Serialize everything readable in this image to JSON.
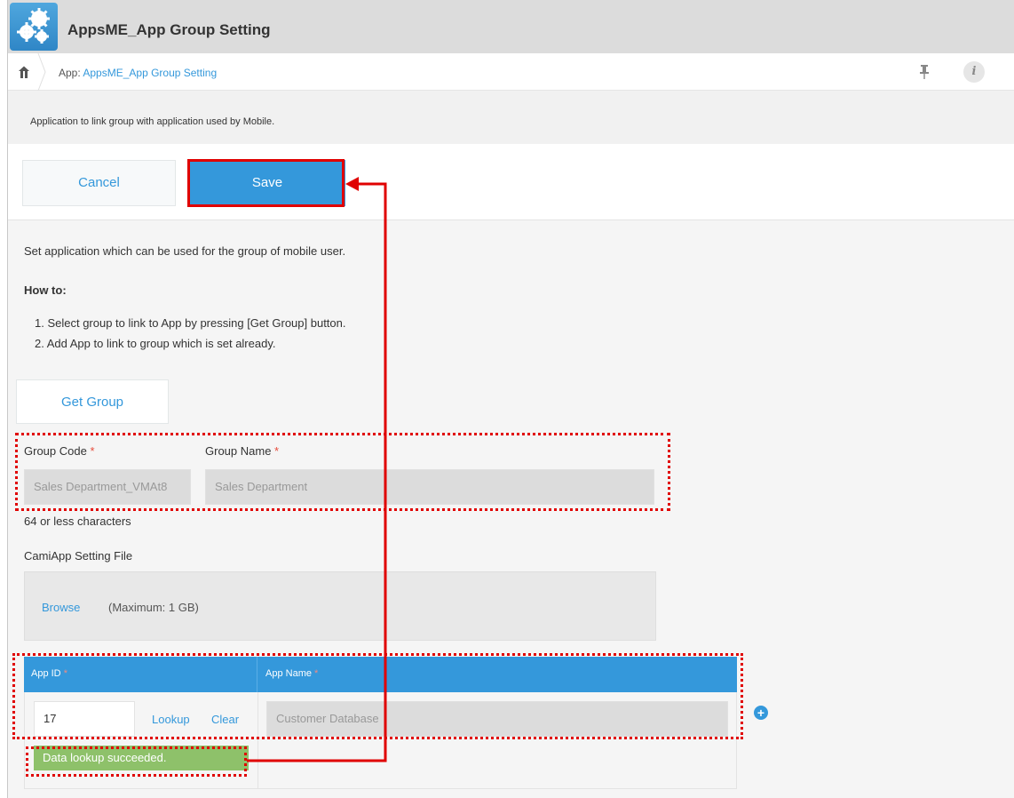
{
  "header": {
    "app_title": "AppsME_App Group Setting"
  },
  "breadcrumb": {
    "prefix": "App: ",
    "link": "AppsME_App Group Setting"
  },
  "description": "Application to link group with application used by Mobile.",
  "toolbar": {
    "cancel_label": "Cancel",
    "save_label": "Save"
  },
  "intro": {
    "text": "Set application which can be used for the group of mobile user.",
    "howto_label": "How to:",
    "steps": [
      "1. Select group to link to App by pressing [Get Group] button.",
      "2. Add App to link to group which is set already."
    ]
  },
  "get_group_label": "Get Group",
  "group": {
    "code_label": "Group Code",
    "code_value": "Sales Department_VMAt8",
    "name_label": "Group Name",
    "name_value": "Sales Department",
    "required_mark": "*",
    "hint": "64 or less characters"
  },
  "file": {
    "label": "CamiApp Setting File",
    "browse_label": "Browse",
    "max_size": "(Maximum: 1 GB)"
  },
  "table": {
    "col_app_id": "App ID",
    "col_app_name": "App Name",
    "row": {
      "app_id": "17",
      "lookup_label": "Lookup",
      "clear_label": "Clear",
      "app_name": "Customer Database"
    },
    "status": "Data lookup succeeded.",
    "add_symbol": "+"
  },
  "colors": {
    "accent": "#3498db",
    "success": "#8ec16a",
    "annotation": "#e00000",
    "required": "#e74c3c"
  },
  "icons": [
    "gear-app-icon",
    "home-icon",
    "pin-icon",
    "info-icon",
    "add-circle-icon"
  ]
}
